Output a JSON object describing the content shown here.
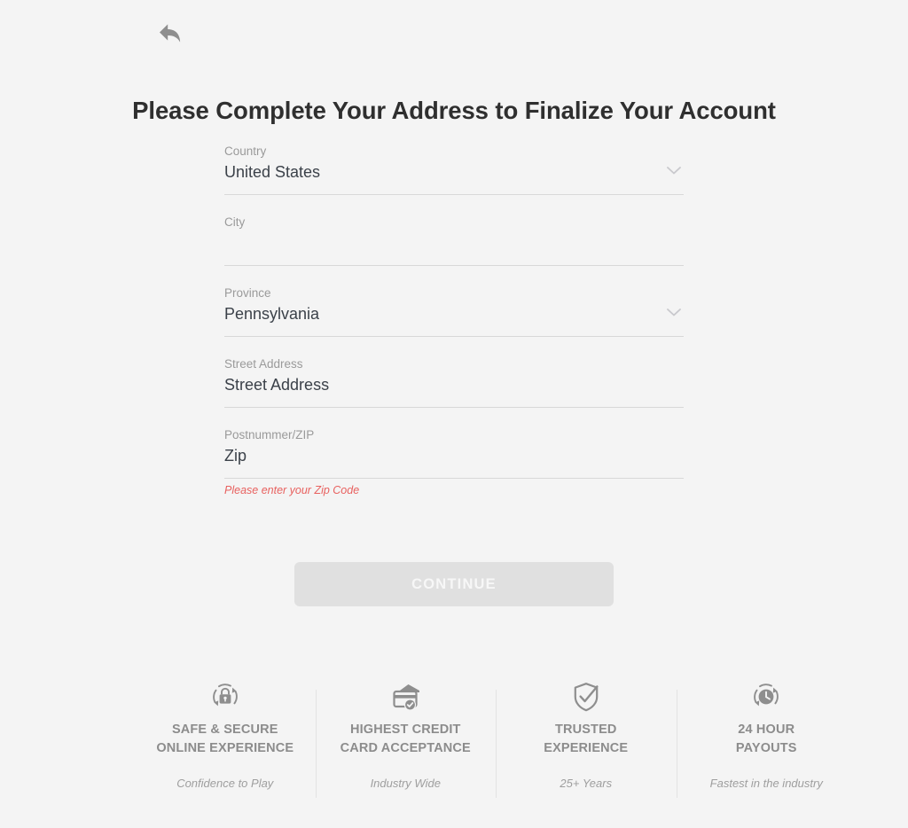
{
  "nav": {
    "back_icon": "back-arrow-icon"
  },
  "header": {
    "title": "Please Complete Your Address to Finalize Your Account"
  },
  "form": {
    "fields": [
      {
        "name": "country",
        "label": "Country",
        "value": "United States",
        "placeholder": "",
        "type": "select",
        "icon": "chevron-down-icon",
        "error": ""
      },
      {
        "name": "city",
        "label": "City",
        "value": "",
        "placeholder": "",
        "type": "text",
        "icon": "",
        "error": ""
      },
      {
        "name": "province",
        "label": "Province",
        "value": "Pennsylvania",
        "placeholder": "",
        "type": "select",
        "icon": "chevron-down-icon",
        "error": ""
      },
      {
        "name": "street-address",
        "label": "Street Address",
        "value": "Street Address",
        "placeholder": "Street Address",
        "type": "text",
        "icon": "",
        "error": ""
      },
      {
        "name": "zip",
        "label": "Postnummer/ZIP",
        "value": "Zip",
        "placeholder": "Zip",
        "type": "text",
        "icon": "",
        "error": "Please enter your Zip Code"
      }
    ],
    "submit_label": "CONTINUE"
  },
  "badges": [
    {
      "icon": "lock-refresh-icon",
      "title": "SAFE & SECURE\nONLINE EXPERIENCE",
      "subtitle": "Confidence to Play"
    },
    {
      "icon": "credit-card-check-icon",
      "title": "HIGHEST CREDIT\nCARD ACCEPTANCE",
      "subtitle": "Industry Wide"
    },
    {
      "icon": "shield-check-icon",
      "title": "TRUSTED\nEXPERIENCE",
      "subtitle": "25+ Years"
    },
    {
      "icon": "clock-refresh-icon",
      "title": "24 HOUR\nPAYOUTS",
      "subtitle": "Fastest in the industry"
    }
  ],
  "colors": {
    "background": "#f4f4f4",
    "title": "#2f2f2f",
    "label": "#9a9a9a",
    "value": "#3b4149",
    "error": "#e8615f",
    "underline": "#d8d8d8",
    "button": "#e0e0e0",
    "badge_text": "#8c8c8c"
  }
}
